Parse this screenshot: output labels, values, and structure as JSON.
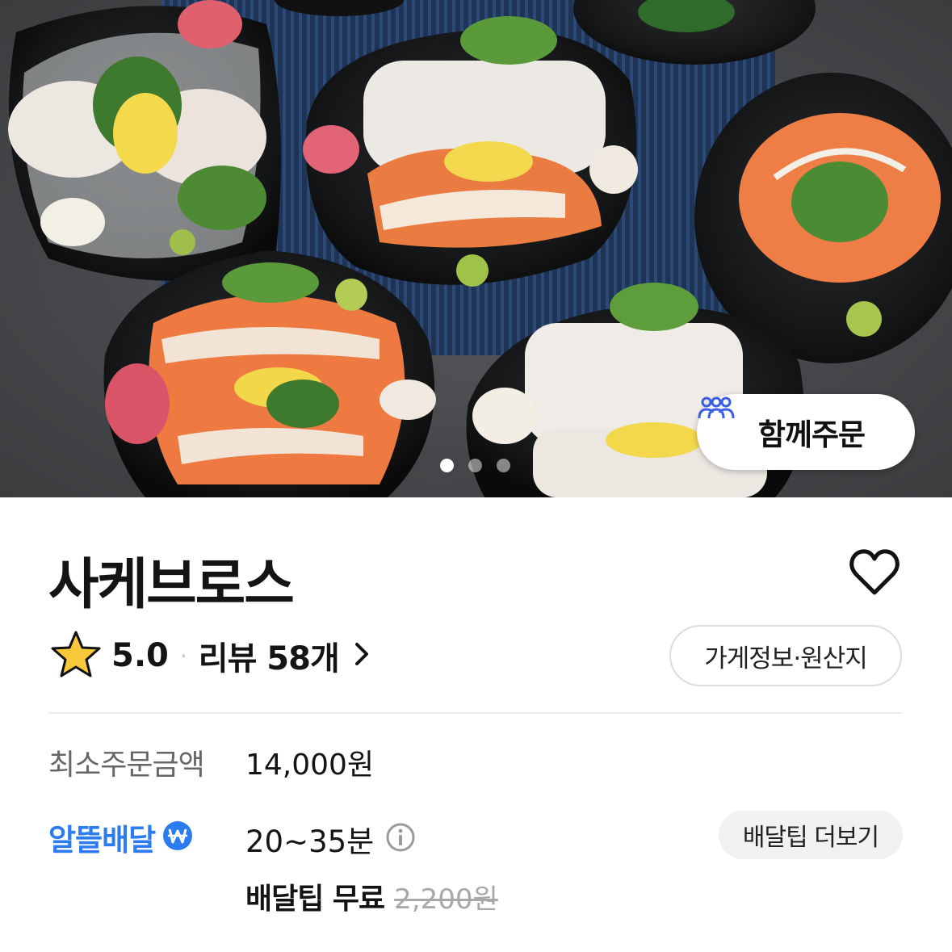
{
  "hero": {
    "image_alt": "sashimi platters",
    "pager": {
      "count": 3,
      "active_index": 0
    },
    "group_order_label": "함께주문"
  },
  "store": {
    "name": "사케브로스",
    "rating": "5.0",
    "separator": "·",
    "review_label": "리뷰 58개",
    "info_button": "가게정보·원산지"
  },
  "order_info": {
    "min_order_label": "최소주문금액",
    "min_order_value": "14,000원",
    "delivery_type": "알뜰배달",
    "delivery_time": "20~35분",
    "tip_more_button": "배달팁 더보기",
    "tip_free": "배달팁 무료",
    "tip_original": "2,200원"
  },
  "colors": {
    "accent_blue": "#2c7bf0",
    "group_icon": "#3b5ee8",
    "star_fill": "#f7c83a"
  },
  "icons": [
    "people-icon",
    "heart-icon",
    "star-icon",
    "chevron-right-icon",
    "won-badge-icon",
    "info-icon"
  ]
}
